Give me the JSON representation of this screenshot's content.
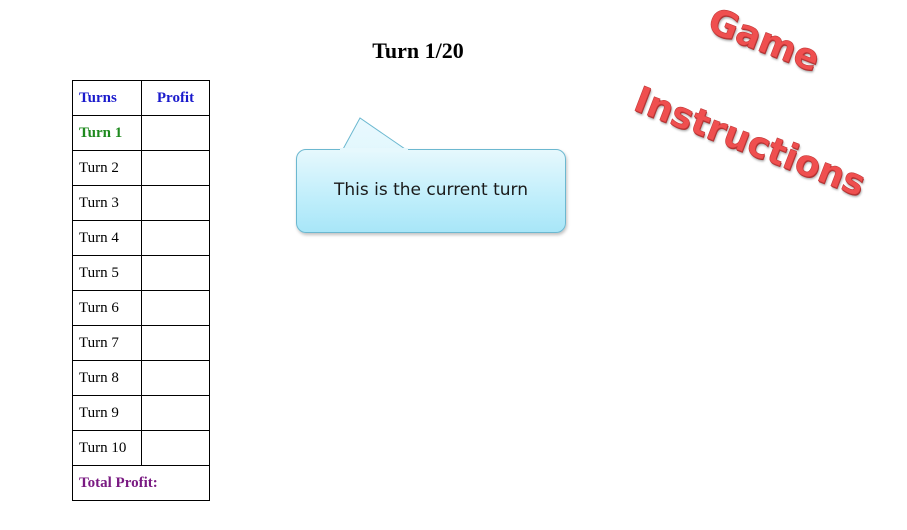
{
  "header": {
    "turn_title": "Turn 1/20"
  },
  "table": {
    "headers": [
      "Turns",
      "Profit"
    ],
    "rows": [
      {
        "turn": "Turn 1",
        "profit": ""
      },
      {
        "turn": "Turn 2",
        "profit": ""
      },
      {
        "turn": "Turn 3",
        "profit": ""
      },
      {
        "turn": "Turn 4",
        "profit": ""
      },
      {
        "turn": "Turn 5",
        "profit": ""
      },
      {
        "turn": "Turn 6",
        "profit": ""
      },
      {
        "turn": "Turn 7",
        "profit": ""
      },
      {
        "turn": "Turn 8",
        "profit": ""
      },
      {
        "turn": "Turn 9",
        "profit": ""
      },
      {
        "turn": "Turn 10",
        "profit": ""
      }
    ],
    "total_label": "Total Profit:"
  },
  "callout": {
    "text": "This is the current turn"
  },
  "instructions_button": {
    "word1": "Game",
    "word2": "Instructions"
  },
  "colors": {
    "header_text": "#1a1acc",
    "current_turn": "#1f8a1f",
    "total_profit": "#7a1a82",
    "instructions": "#ef4f4f",
    "callout_fill": "#bfeefb"
  }
}
